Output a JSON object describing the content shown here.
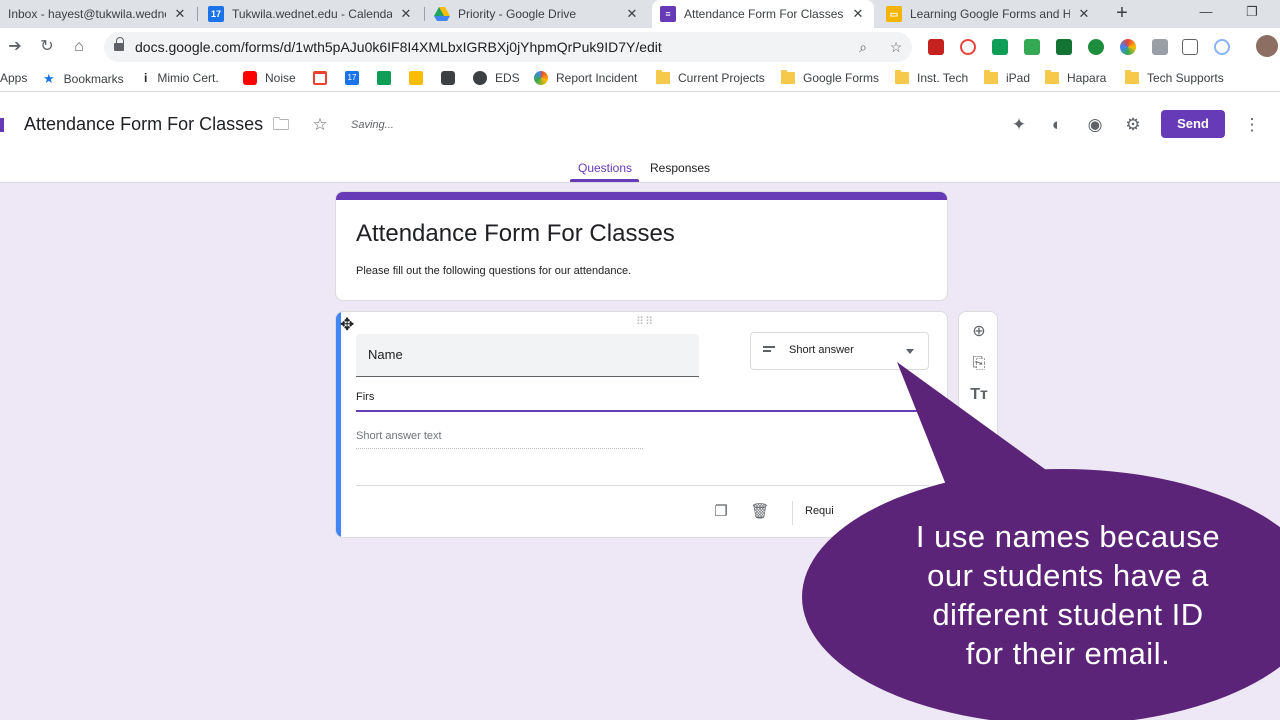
{
  "browser": {
    "tabs": [
      {
        "title": "Inbox - hayest@tukwila.wedne",
        "icon": "gmail-icon",
        "active": false
      },
      {
        "title": "Tukwila.wednet.edu - Calenda",
        "icon": "calendar-icon",
        "active": false
      },
      {
        "title": "Priority - Google Drive",
        "icon": "drive-icon",
        "active": false
      },
      {
        "title": "Attendance Form For Classes -",
        "icon": "forms-icon",
        "active": true
      },
      {
        "title": "Learning Google Forms and H",
        "icon": "slides-icon",
        "active": false
      }
    ],
    "new_tab_glyph": "+",
    "url": "docs.google.com/forms/d/1wth5pAJu0k6IF8I4XMLbxIGRBXj0jYhpmQrPuk9ID7Y/edit",
    "calendar_day": "17"
  },
  "bookmarks": [
    {
      "label": "Apps",
      "icon": "apps-icon"
    },
    {
      "label": "Bookmarks",
      "icon": "star-icon"
    },
    {
      "label": "Mimio Cert.",
      "icon": "info-icon"
    },
    {
      "label": "Noise",
      "icon": "youtube-icon"
    },
    {
      "label": "",
      "icon": "gmail-icon"
    },
    {
      "label": "17",
      "icon": "calendar-icon"
    },
    {
      "label": "",
      "icon": "classroom-icon"
    },
    {
      "label": "",
      "icon": "keep-icon"
    },
    {
      "label": "",
      "icon": "screen-icon"
    },
    {
      "label": "EDS",
      "icon": "globe-icon"
    },
    {
      "label": "Report Incident",
      "icon": "pinwheel-icon"
    },
    {
      "label": "Current Projects",
      "icon": "folder-icon"
    },
    {
      "label": "Google Forms",
      "icon": "folder-icon"
    },
    {
      "label": "Inst. Tech",
      "icon": "folder-icon"
    },
    {
      "label": "iPad",
      "icon": "folder-icon"
    },
    {
      "label": "Hapara",
      "icon": "folder-icon"
    },
    {
      "label": "Tech Supports",
      "icon": "folder-icon"
    }
  ],
  "form_header": {
    "doc_title": "Attendance Form For Classes",
    "status": "Saving...",
    "send_label": "Send",
    "tabs": [
      "Questions",
      "Responses"
    ],
    "active_tab": "Questions"
  },
  "form": {
    "title": "Attendance Form For Classes",
    "description": "Please fill out the following questions for our attendance."
  },
  "question": {
    "title": "Name",
    "type": "Short answer",
    "description_value": "Firs",
    "answer_placeholder": "Short answer text",
    "required_label": "Requi"
  },
  "callout": {
    "lines": [
      "I use names because",
      "our students have a",
      "different student ID",
      "for their email."
    ]
  },
  "colors": {
    "accent": "#673ab7",
    "question_bar": "#4285f4",
    "callout": "#5c2478",
    "background": "#ede7f6"
  }
}
